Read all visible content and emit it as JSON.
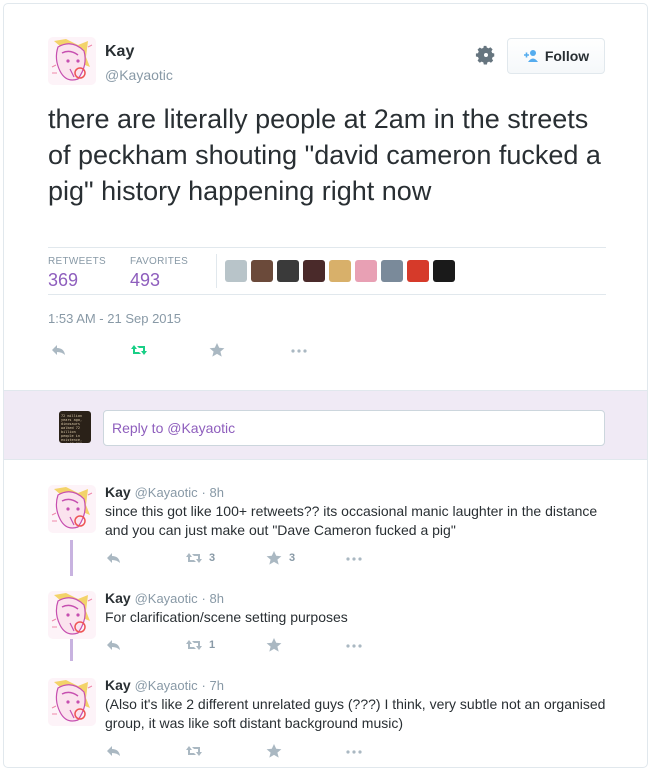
{
  "tweet": {
    "author_name": "Kay",
    "author_handle": "@Kayaotic",
    "follow_label": "Follow",
    "text": "there are literally people at 2am in the streets of peckham shouting \"david cameron fucked a pig\" history happening right now",
    "retweets_label": "RETWEETS",
    "retweets_count": "369",
    "favorites_label": "FAVORITES",
    "favorites_count": "493",
    "timestamp": "1:53 AM - 21 Sep 2015",
    "favoriter_avatar_colors": [
      "#b8c4c9",
      "#6b4a3a",
      "#3a3a3a",
      "#4a2a2a",
      "#d8b06a",
      "#e8a0b4",
      "#7a8a9a",
      "#d63a2a",
      "#1a1a1a"
    ]
  },
  "reply_box": {
    "placeholder": "Reply to @Kayaotic",
    "avatar_caption": "72 million years ago, dinosaurs walked 72 billion people in existence, and 47,000 now die"
  },
  "colors": {
    "accent": "#8e5ebd",
    "retweet_green": "#19cf86",
    "muted": "#8899a6"
  },
  "replies": [
    {
      "name": "Kay",
      "handle": "@Kayaotic",
      "time": "· 8h",
      "text": "since this got like 100+ retweets?? its occasional manic laughter in the distance and you can just make out \"Dave Cameron fucked a pig\"",
      "retweets": "3",
      "favorites": "3"
    },
    {
      "name": "Kay",
      "handle": "@Kayaotic",
      "time": "· 8h",
      "text": "For clarification/scene setting purposes",
      "retweets": "1",
      "favorites": ""
    },
    {
      "name": "Kay",
      "handle": "@Kayaotic",
      "time": "· 7h",
      "text": "(Also it's like 2 different unrelated guys (???) I think, very subtle not an organised group, it was like soft distant background music)",
      "retweets": "",
      "favorites": ""
    }
  ]
}
